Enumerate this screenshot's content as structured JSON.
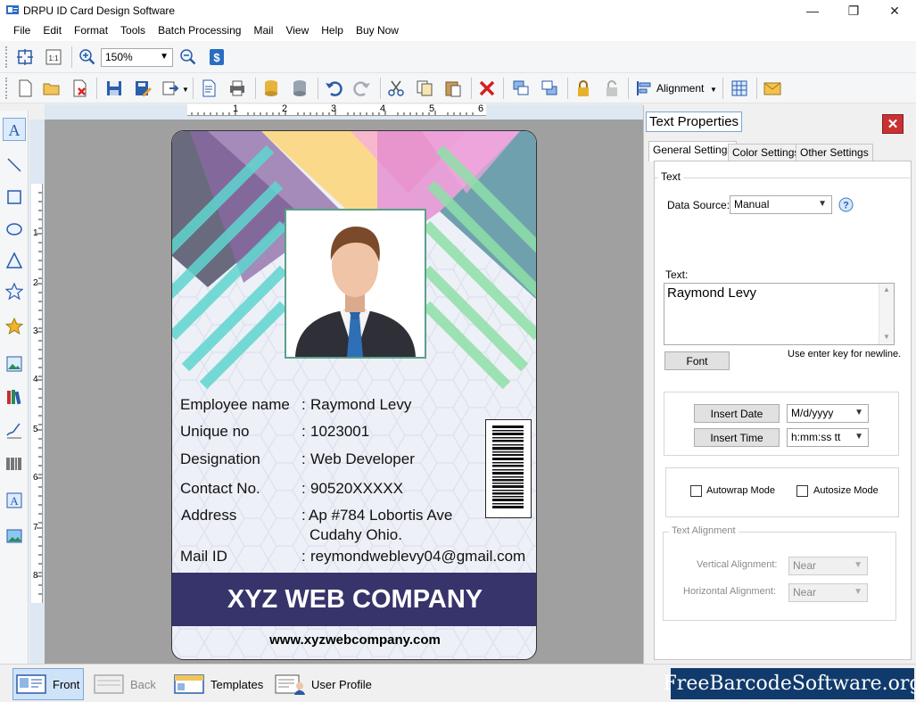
{
  "window": {
    "title": "DRPU ID Card Design Software",
    "minimize_icon": "minimize-icon",
    "maximize_icon": "restore-icon",
    "close_icon": "close-icon"
  },
  "menu": [
    "File",
    "Edit",
    "Format",
    "Tools",
    "Batch Processing",
    "Mail",
    "View",
    "Help",
    "Buy Now"
  ],
  "toolbar": {
    "zoom_value": "150%",
    "alignment_label": "Alignment",
    "one_to_one_label": "1:1"
  },
  "ruler": {
    "horizontal_marks": [
      "1",
      "2",
      "3",
      "4",
      "5",
      "6"
    ],
    "vertical_marks": [
      "1",
      "2",
      "3",
      "4",
      "5",
      "6",
      "7",
      "8"
    ]
  },
  "card": {
    "fields": [
      {
        "label": "Employee name",
        "sep": ":",
        "value": "Raymond Levy"
      },
      {
        "label": "Unique no",
        "sep": ":",
        "value": "1023001"
      },
      {
        "label": "Designation",
        "sep": ":",
        "value": "Web Developer"
      },
      {
        "label": "Contact No.",
        "sep": ":",
        "value": "90520XXXXX"
      },
      {
        "label": "Address",
        "sep": ":",
        "value": "Ap #784 Lobortis Ave"
      },
      {
        "label": "Mail ID",
        "sep": ":",
        "value": "reymondweblevy04@gmail.com"
      }
    ],
    "address_line2": "Cudahy Ohio.",
    "company": "XYZ WEB COMPANY",
    "website": "www.xyzwebcompany.com"
  },
  "panel": {
    "title": "Text Properties",
    "tabs": [
      "General Settings",
      "Color Settings",
      "Other Settings"
    ],
    "text_group": "Text",
    "data_source_label": "Data Source:",
    "data_source_value": "Manual",
    "text_label": "Text:",
    "text_value": "Raymond Levy",
    "font_button": "Font",
    "newline_hint": "Use enter key for newline.",
    "insert_date_button": "Insert Date",
    "date_format": "M/d/yyyy",
    "insert_time_button": "Insert Time",
    "time_format": "h:mm:ss tt",
    "autowrap_label": "Autowrap Mode",
    "autosize_label": "Autosize Mode",
    "alignment_group": "Text Alignment",
    "vertical_label": "Vertical Alignment:",
    "vertical_value": "Near",
    "horizontal_label": "Horizontal  Alignment:",
    "horizontal_value": "Near"
  },
  "bottom": {
    "front": "Front",
    "back": "Back",
    "templates": "Templates",
    "user_profile": "User Profile",
    "brand": "FreeBarcodeSoftware.org"
  },
  "colors": {
    "company_bar": "#37336b",
    "brand_bg": "#103a6b",
    "close_red": "#c83232"
  }
}
